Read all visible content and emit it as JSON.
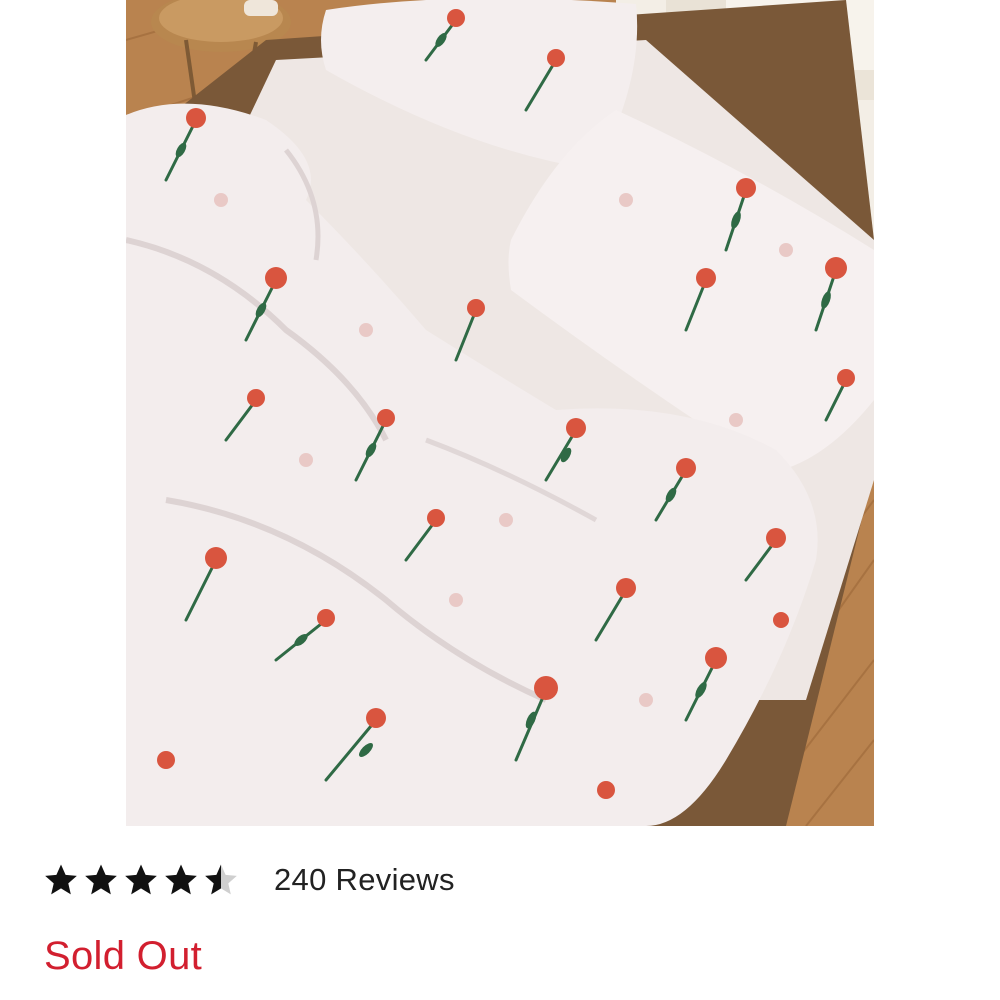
{
  "product": {
    "image_alt": "Floral duvet cover set on bed",
    "rating": 4.5,
    "rating_max": 5,
    "reviews_label": "240 Reviews",
    "status_label": "Sold Out"
  },
  "colors": {
    "status": "#d21f2f",
    "star": "#111111",
    "star_empty": "#cfcfcf",
    "text": "#222222"
  },
  "icons": {
    "star_full": "star-icon",
    "star_half": "star-half-icon"
  }
}
